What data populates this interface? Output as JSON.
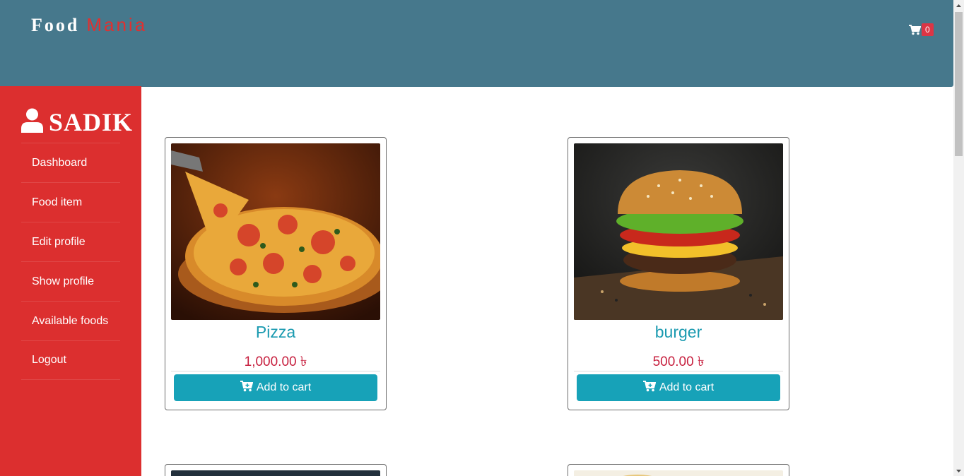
{
  "header": {
    "brand_main": "Food",
    "brand_accent": "Mania",
    "cart_count": "0",
    "cart_icon": "cart-icon"
  },
  "sidebar": {
    "user_icon": "user-icon",
    "username": "SADIK",
    "items": [
      {
        "label": "Dashboard"
      },
      {
        "label": "Food item"
      },
      {
        "label": "Edit profile"
      },
      {
        "label": "Show profile"
      },
      {
        "label": "Available foods"
      },
      {
        "label": "Logout"
      }
    ]
  },
  "products": [
    {
      "name": "Pizza",
      "price": "1,000.00 ৳",
      "button": "Add to cart",
      "icon": "cart-plus-icon"
    },
    {
      "name": "burger",
      "price": "500.00 ৳",
      "button": "Add to cart",
      "icon": "cart-plus-icon"
    }
  ],
  "colors": {
    "header_bg": "#46788c",
    "sidebar_bg": "#dc2f2f",
    "accent_red": "#e03030",
    "title_teal": "#1a9ab0",
    "price_red": "#c7203f",
    "button_bg": "#17a2b8"
  }
}
